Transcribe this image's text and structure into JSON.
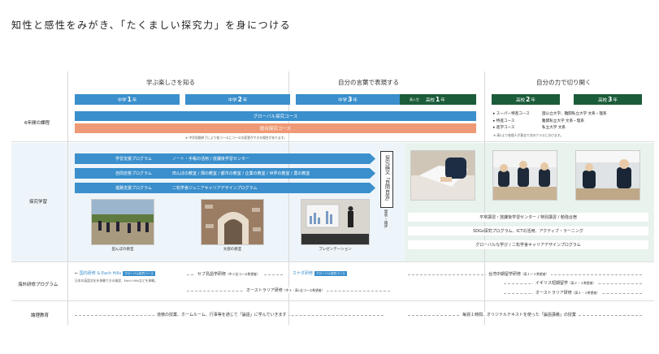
{
  "title": "知性と感性をみがき、「たくましい探究力」を身につける",
  "phases": [
    "学ぶ楽しさを知る",
    "自分の言葉で表現する",
    "自分の力で切り開く"
  ],
  "years": [
    {
      "pre": "中学",
      "num": "1",
      "post": "年"
    },
    {
      "pre": "中学",
      "num": "2",
      "post": "年"
    },
    {
      "pre": "中学",
      "num": "3",
      "post": "年"
    },
    {
      "pre": "高校",
      "num": "1",
      "post": "年",
      "tag": "高入生"
    },
    {
      "pre": "高校",
      "num": "2",
      "post": "年"
    },
    {
      "pre": "高校",
      "num": "3",
      "post": "年"
    }
  ],
  "row_labels": {
    "course": "6年間の課程",
    "inquiry": "探究学習",
    "overseas": "海外研修プログラム",
    "logic": "論理教育"
  },
  "course_bars": {
    "global": "グローバル探究コース",
    "sogo": "総合探究コース",
    "note": "※ 中学段階修了により各コースにコースの変更ができる場合があります。"
  },
  "upper_courses": [
    {
      "name": "スーパー特進コース",
      "dest": "国公立大学、難関私立大学 文系・理系"
    },
    {
      "name": "特進コース",
      "dest": "難関私立大学 文系・理系"
    },
    {
      "name": "進学コース",
      "dest": "私立大学 文系"
    }
  ],
  "upper_note": "※ 高2より各個人が意志で次のクラスに分けます。",
  "programs": [
    {
      "name": "学習支援プログラム",
      "desc": "ノート・手帳の活用 / 放課後学習センター"
    },
    {
      "name": "自問自答プログラム",
      "desc": "田んぼの教室 / 畑の教室 / 都市の教室 / 企業の教室 / 世界の教室 / 農の教室"
    },
    {
      "name": "進路支援プログラム",
      "desc": "二松学舎ジュニアキャリアデザインプログラム"
    }
  ],
  "thesis_label": "探究論文「自問自答」",
  "thesis_sub": "発表・論評",
  "photo_captions": [
    "田んぼの教室",
    "文部の教室",
    "プレゼンテーション"
  ],
  "upper_programs": [
    "平常講習・放課後学習センター / 特別講習 / 勉強合宿",
    "SDGs探究プログラム、ICTの活用、アクティブ・ラーニング",
    "グローバルな学び / 二松学舎キャリアデザインプログラム"
  ],
  "overseas": {
    "domestic": "国内研修 & Each Hills",
    "domestic_tag": "グローバル探究コース",
    "domestic_note": "日本の英語文化を体験できる施設、Each Hillsなどを体験。",
    "cebu": "セブ島語学研修",
    "cebu_note": "（中３全コース希望者）",
    "canada": "カナダ研修",
    "canada_tag": "グローバル探究コース",
    "australia": "オーストラリア研修",
    "australia_note": "（中３・高1全コース希望者）",
    "taiwan": "台湾中期留学研修",
    "taiwan_note": "（高１〜２希望者）",
    "uk": "イギリス短期留学",
    "uk_note": "（高２・３希望者）",
    "aus2": "オーストラリア研修",
    "aus2_note": "（高２・３希望者）"
  },
  "logic": {
    "left": "道徳の授業、ホームルーム、行事等を通じて「論語」に学んでいきます",
    "right": "毎週１時間、オリジナルテキストを使った「論語講義」の授業"
  },
  "colors": {
    "blue": "#3a8fcc",
    "orange": "#ef9a77",
    "green": "#1b5c3a",
    "pale": "#e9f3ee"
  }
}
